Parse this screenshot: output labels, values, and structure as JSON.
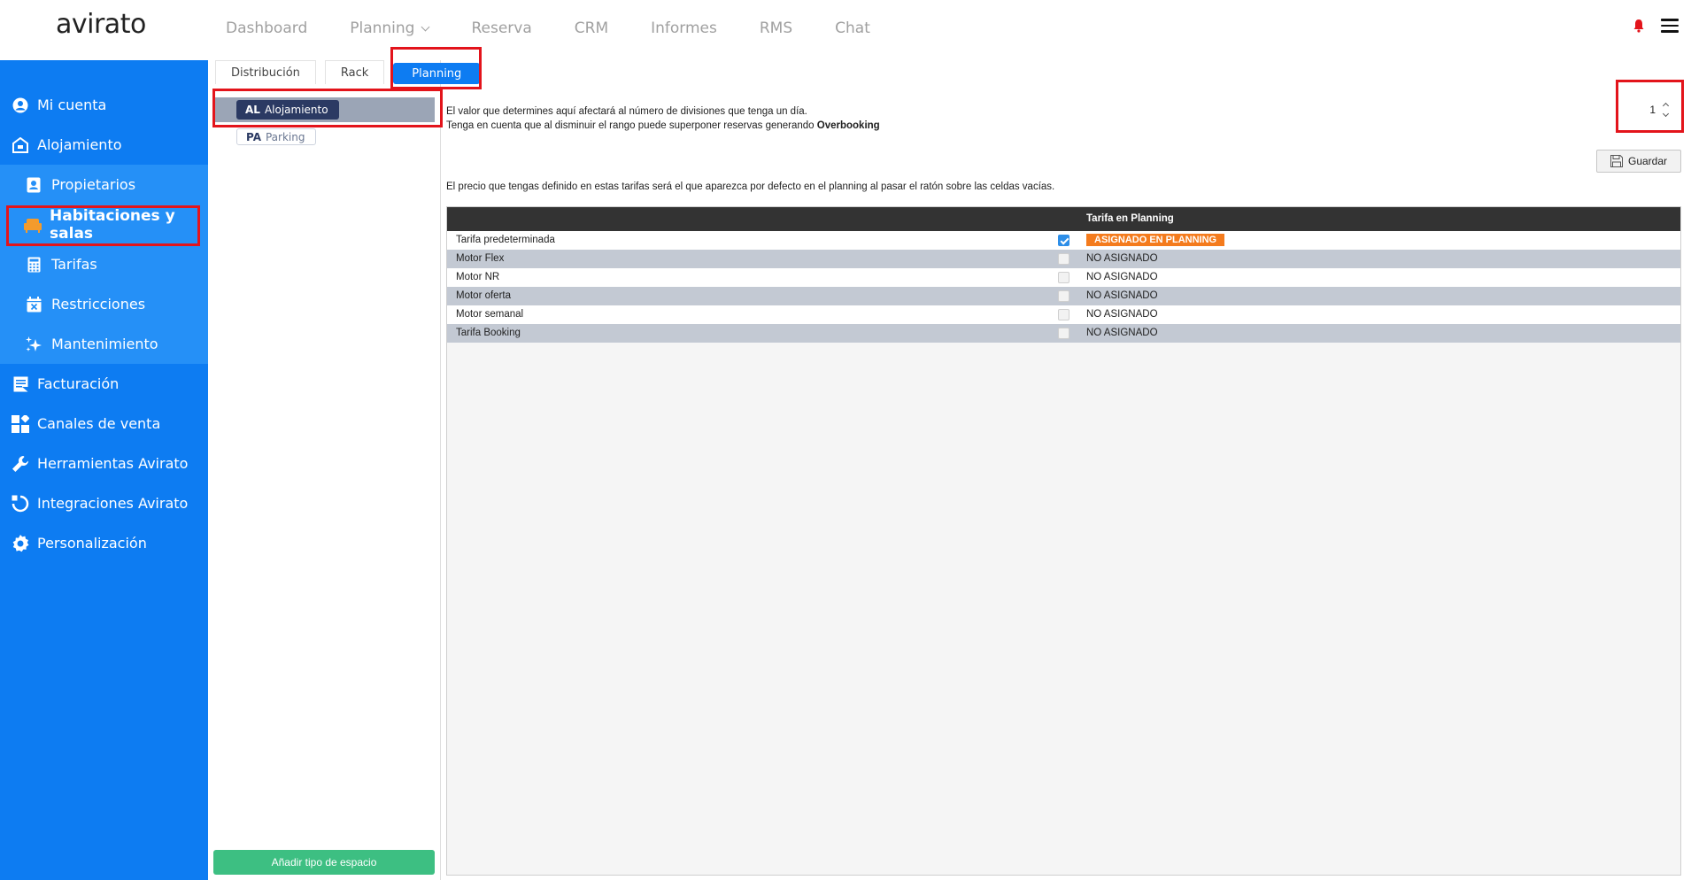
{
  "app": {
    "logo": "avirato",
    "topnav": [
      {
        "label": "Dashboard"
      },
      {
        "label": "Planning"
      },
      {
        "label": "Reserva"
      },
      {
        "label": "CRM"
      },
      {
        "label": "Informes"
      },
      {
        "label": "RMS"
      },
      {
        "label": "Chat"
      }
    ]
  },
  "sidebar": {
    "items": [
      {
        "label": "Mi cuenta",
        "icon": "user-circle-icon"
      },
      {
        "label": "Alojamiento",
        "icon": "hotel-icon"
      },
      {
        "label": "Propietarios",
        "icon": "owner-card-icon"
      },
      {
        "label": "Habitaciones y salas",
        "icon": "sofa-icon"
      },
      {
        "label": "Tarifas",
        "icon": "calculator-icon"
      },
      {
        "label": "Restricciones",
        "icon": "calendar-x-icon"
      },
      {
        "label": "Mantenimiento",
        "icon": "sparkles-icon"
      },
      {
        "label": "Facturación",
        "icon": "invoice-icon"
      },
      {
        "label": "Canales de venta",
        "icon": "grid-icon"
      },
      {
        "label": "Herramientas Avirato",
        "icon": "wrench-icon"
      },
      {
        "label": "Integraciones Avirato",
        "icon": "integration-icon"
      },
      {
        "label": "Personalización",
        "icon": "gear-icon"
      }
    ]
  },
  "tabs": [
    {
      "label": "Distribución"
    },
    {
      "label": "Rack"
    },
    {
      "label": "Planning"
    }
  ],
  "spaces": [
    {
      "code": "AL",
      "label": "Alojamiento"
    },
    {
      "code": "PA",
      "label": "Parking"
    }
  ],
  "add_space_label": "Añadir tipo de espacio",
  "info": {
    "line1": "El valor que determines aquí afectará al número de divisiones que tenga un día.",
    "line2": "Tenga en cuenta que al disminuir el rango puede superponer reservas generando ",
    "line2_bold": "Overbooking"
  },
  "divisions_value": "1",
  "save_label": "Guardar",
  "price_note": "El precio que tengas definido en estas tarifas será el que aparezca por defecto en el planning al pasar el ratón sobre las celdas vacías.",
  "grid": {
    "header": "Tarifa en Planning",
    "rows": [
      {
        "name": "Tarifa predeterminada",
        "checked": true,
        "status": "ASIGNADO EN PLANNING"
      },
      {
        "name": "Motor Flex",
        "checked": false,
        "status": "NO ASIGNADO"
      },
      {
        "name": "Motor NR",
        "checked": false,
        "status": "NO ASIGNADO"
      },
      {
        "name": "Motor oferta",
        "checked": false,
        "status": "NO ASIGNADO"
      },
      {
        "name": "Motor semanal",
        "checked": false,
        "status": "NO ASIGNADO"
      },
      {
        "name": "Tarifa Booking",
        "checked": false,
        "status": "NO ASIGNADO"
      }
    ]
  },
  "colors": {
    "sidebar": "#0d7cf2",
    "sidebar_sub": "#2590f7",
    "accent_orange": "#f47b1d",
    "highlight_red": "#e3141b",
    "add_button": "#3dbf82"
  }
}
